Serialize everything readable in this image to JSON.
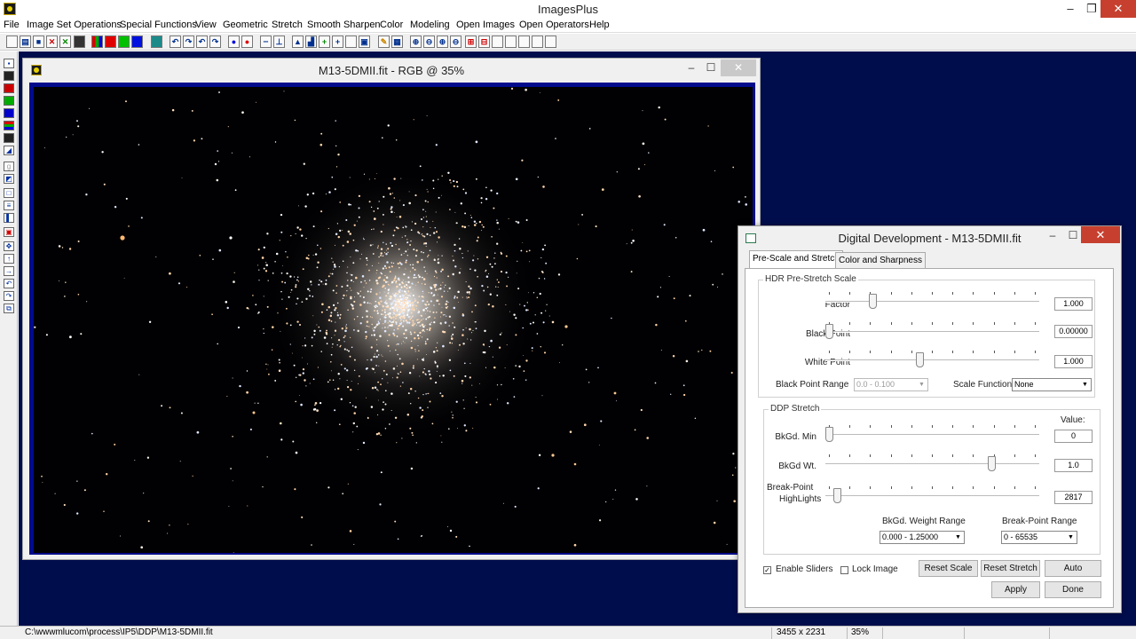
{
  "app": {
    "title": "ImagesPlus",
    "minimize": "–",
    "restore": "❐",
    "close": "✕"
  },
  "menu": [
    "File",
    "Image Set Operations",
    "Special Functions",
    "View",
    "Geometric",
    "Stretch",
    "Smooth Sharpen",
    "Color",
    "Modeling",
    "Open Images",
    "Open Operators",
    "Help"
  ],
  "image_window": {
    "title": "M13-5DMII.fit - RGB @ 35%",
    "minimize": "–",
    "maximize": "☐",
    "close": "✕"
  },
  "dialog": {
    "title": "Digital Development - M13-5DMII.fit",
    "minimize": "–",
    "maximize": "☐",
    "close": "✕",
    "tabs": [
      "Pre-Scale and Stretch",
      "Color and Sharpness"
    ],
    "hdr": {
      "title": "HDR Pre-Stretch Scale",
      "factor": {
        "label": "Factor",
        "value": "1.000",
        "position": 0.21
      },
      "black_point": {
        "label": "Black Point",
        "value": "0.00000",
        "position": 0.0
      },
      "white_point": {
        "label": "White Point",
        "value": "1.000",
        "position": 0.44
      },
      "bp_range_label": "Black Point Range",
      "bp_range_value": "0.0 - 0.100",
      "scale_fn_label": "Scale Function",
      "scale_fn_value": "None"
    },
    "ddp": {
      "title": "DDP Stretch",
      "value_header": "Value:",
      "bkgd_min": {
        "label": "BkGd. Min",
        "value": "0",
        "position": 0.0
      },
      "bkgd_wt": {
        "label": "BkGd Wt.",
        "value": "1.0",
        "position": 0.79
      },
      "break_point": {
        "label_1": "Break-Point",
        "label_2": "HighLights",
        "value": "2817",
        "position": 0.04
      },
      "weight_range_label": "BkGd. Weight Range",
      "weight_range_value": "0.000 - 1.25000",
      "bp_range_label": "Break-Point Range",
      "bp_range_value": "0 - 65535"
    },
    "enable_sliders": {
      "label": "Enable Sliders",
      "checked": "✓"
    },
    "lock_image": {
      "label": "Lock Image"
    },
    "buttons": {
      "reset_scale": "Reset Scale",
      "reset_stretch": "Reset Stretch",
      "auto": "Auto",
      "apply": "Apply",
      "done": "Done"
    }
  },
  "status": {
    "path": "C:\\wwwmlucom\\process\\IP5\\DDP\\M13-5DMII.fit",
    "dimensions": "3455 x 2231",
    "zoom": "35%"
  },
  "colors": {
    "workspace": "#000d4c",
    "image_border": "#000c8c",
    "close_red": "#c7402f"
  }
}
